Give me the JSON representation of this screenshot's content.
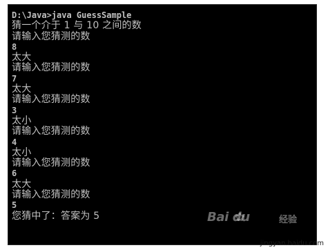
{
  "console": {
    "lines": [
      "D:\\Java>java GuessSample",
      "猜一个介于 1 与 10 之间的数",
      "请输入您猜测的数",
      "8",
      "太大",
      "请输入您猜测的数",
      "7",
      "太大",
      "请输入您猜测的数",
      "3",
      "太小",
      "请输入您猜测的数",
      "4",
      "太小",
      "请输入您猜测的数",
      "6",
      "太大",
      "请输入您猜测的数",
      "5",
      "您猜中了：答案为 5"
    ]
  },
  "watermark": {
    "brand": "Bai du",
    "jingyan": "经验",
    "url": "jingyan.baidu.com",
    "paw_icon": "baidu-paw-icon"
  },
  "colors": {
    "console_bg": "#000000",
    "console_text": "#c0c0c0",
    "page_bg": "#ffffff"
  }
}
